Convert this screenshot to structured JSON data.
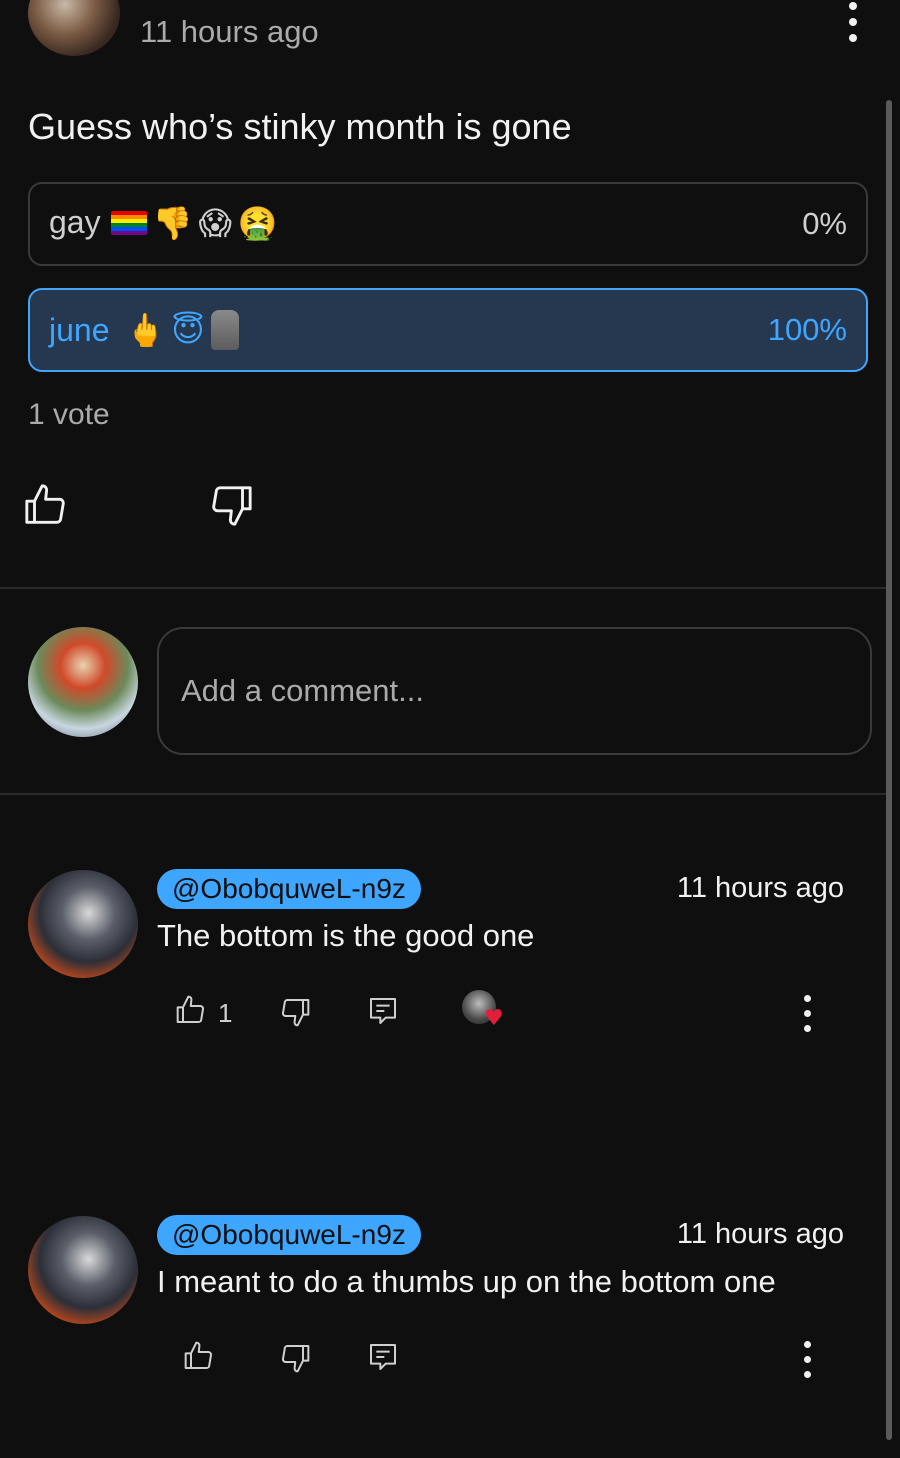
{
  "post": {
    "time": "11 hours ago",
    "text": "Guess who’s stinky month is gone",
    "poll": {
      "options": [
        {
          "label": "gay",
          "emojis": [
            "🏳️‍🌈",
            "👎",
            "🫣",
            "🤮"
          ],
          "percent": "0%",
          "selected": false,
          "share": 0
        },
        {
          "label": "june",
          "emojis": [
            "🖕",
            "😇",
            "🗿"
          ],
          "percent": "100%",
          "selected": true,
          "share": 1
        }
      ],
      "votes": "1 vote"
    }
  },
  "comment_input": {
    "placeholder": "Add a comment..."
  },
  "comments": [
    {
      "handle": "@ObobquweL-n9z",
      "time": "11 hours ago",
      "text": "The bottom is the good one",
      "likes": "1",
      "creator_heart": true
    },
    {
      "handle": "@ObobquweL-n9z",
      "time": "11 hours ago",
      "text": "I  meant to do a thumbs up on the bottom one",
      "likes": "",
      "creator_heart": false
    }
  ],
  "colors": {
    "background": "#0f0f0f",
    "accent": "#3ea6ff",
    "selected_fill": "#263850",
    "muted_text": "#aaaaaa"
  },
  "icons": [
    "more-vert-icon",
    "thumbs-up-icon",
    "thumbs-down-icon",
    "reply-icon",
    "heart-icon"
  ]
}
